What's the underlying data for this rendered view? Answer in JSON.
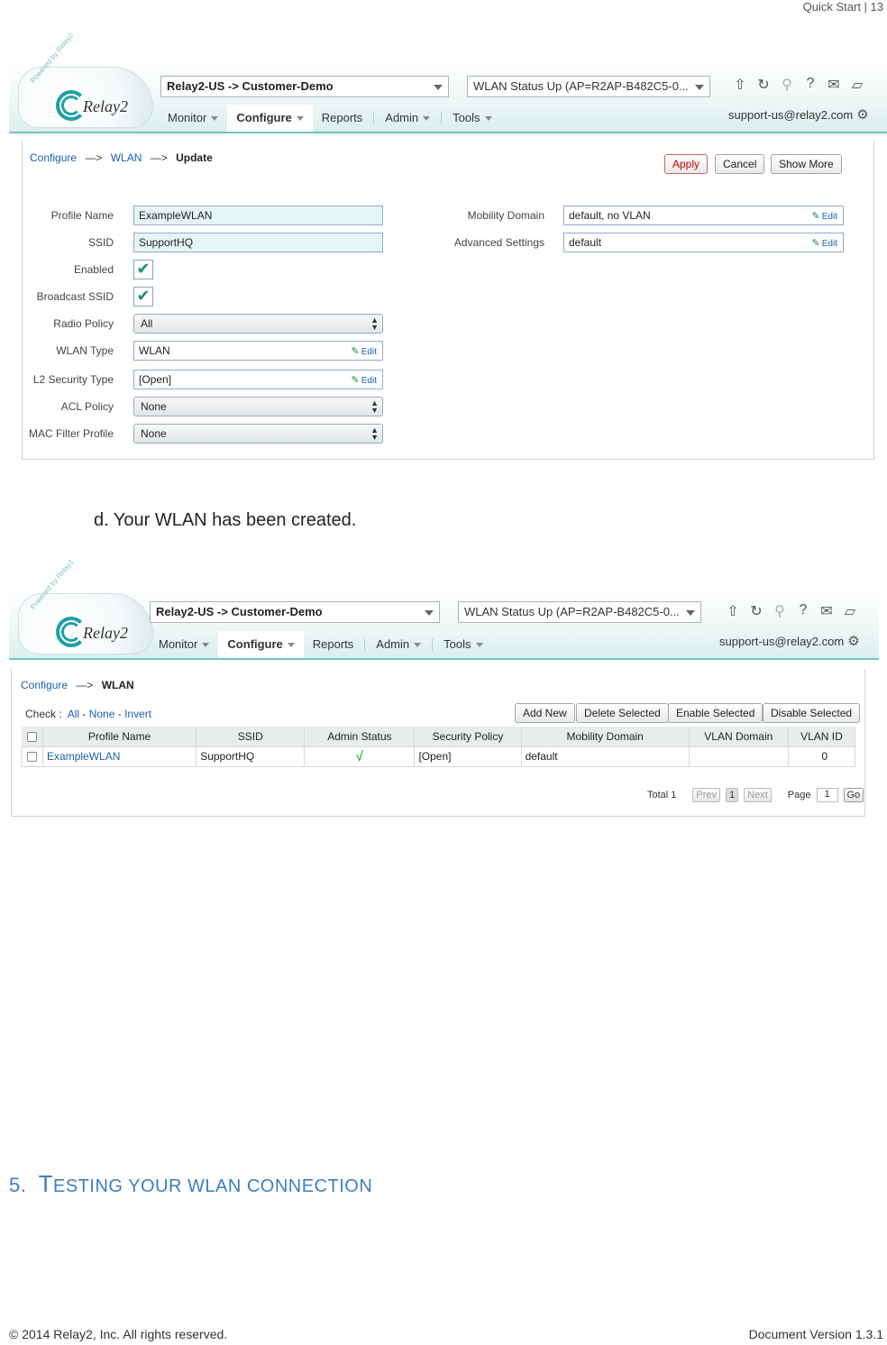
{
  "page": {
    "header": "Quick Start | 13",
    "step_text": "d.   Your WLAN has been created.",
    "section_number": "5.",
    "section_title_first": "T",
    "section_title_rest": "esting your WLAN connection",
    "footer_left": "© 2014 Relay2, Inc. All rights reserved.",
    "footer_right": "Document Version 1.3.1"
  },
  "app": {
    "logo_text": "Relay2",
    "logo_powered": "Powered by Relay2",
    "org_select": "Relay2-US -> Customer-Demo",
    "status_select": "WLAN Status Up (AP=R2AP-B482C5-0...",
    "nav": [
      "Monitor",
      "Configure",
      "Reports",
      "Admin",
      "Tools"
    ],
    "support_email": "support-us@relay2.com",
    "icons": [
      "upload-icon",
      "refresh-icon",
      "search-icon",
      "help-icon",
      "mail-icon",
      "device-icon",
      "gear-icon"
    ]
  },
  "update_form": {
    "breadcrumb": [
      "Configure",
      "WLAN",
      "Update"
    ],
    "breadcrumb_arrow": "—>",
    "buttons": {
      "apply": "Apply",
      "cancel": "Cancel",
      "show_more": "Show More"
    },
    "labels": {
      "profile_name": "Profile Name",
      "ssid": "SSID",
      "enabled": "Enabled",
      "broadcast_ssid": "Broadcast SSID",
      "radio_policy": "Radio Policy",
      "wlan_type": "WLAN Type",
      "l2_security": "L2 Security Type",
      "acl_policy": "ACL Policy",
      "mac_filter": "MAC Filter Profile",
      "mobility_domain": "Mobility Domain",
      "advanced_settings": "Advanced Settings"
    },
    "values": {
      "profile_name": "ExampleWLAN",
      "ssid": "SupportHQ",
      "enabled": true,
      "broadcast_ssid": true,
      "radio_policy": "All",
      "wlan_type": "WLAN",
      "l2_security": "[Open]",
      "acl_policy": "None",
      "mac_filter": "None",
      "mobility_domain": "default, no VLAN",
      "advanced_settings": "default"
    },
    "edit_label": "Edit",
    "check_glyph": "✔"
  },
  "wlan_list": {
    "breadcrumb": [
      "Configure",
      "WLAN"
    ],
    "breadcrumb_arrow": "—>",
    "check_label": "Check :",
    "check_links": [
      "All",
      "None",
      "Invert"
    ],
    "buttons": [
      "Add New",
      "Delete Selected",
      "Enable Selected",
      "Disable Selected"
    ],
    "columns": [
      "Profile Name",
      "SSID",
      "Admin Status",
      "Security Policy",
      "Mobility Domain",
      "VLAN Domain",
      "VLAN ID"
    ],
    "rows": [
      {
        "profile_name": "ExampleWLAN",
        "ssid": "SupportHQ",
        "admin_status": "√",
        "security_policy": "[Open]",
        "mobility_domain": "default",
        "vlan_domain": "",
        "vlan_id": "0"
      }
    ],
    "pager": {
      "total": "Total 1",
      "prev": "Prev",
      "current": "1",
      "next": "Next",
      "page_label": "Page",
      "page_value": "1",
      "go": "Go"
    }
  }
}
